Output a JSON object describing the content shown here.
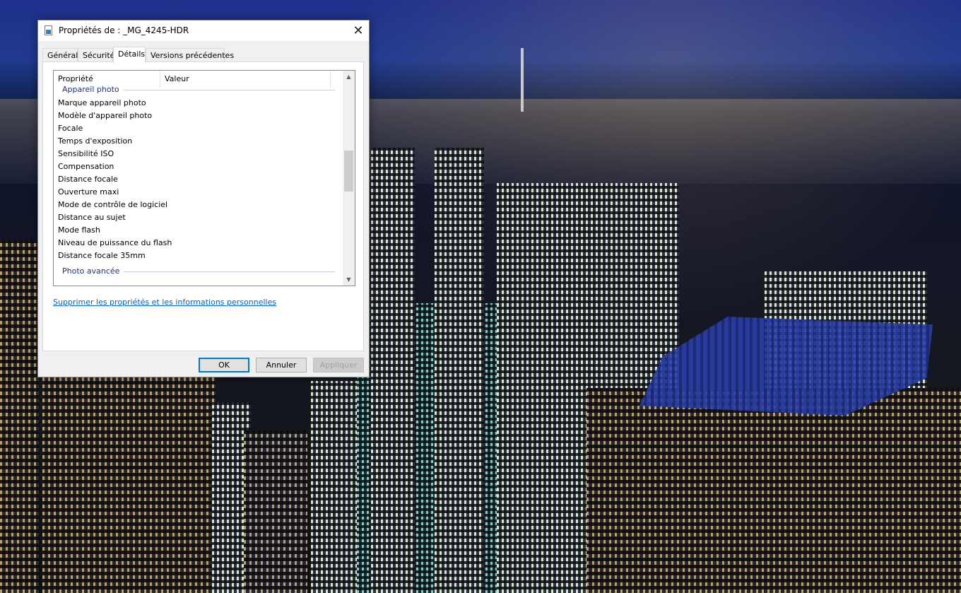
{
  "dialog": {
    "title": "Propriétés de : _MG_4245-HDR",
    "close_label": "✕",
    "tabs": [
      {
        "label": "Général"
      },
      {
        "label": "Sécurité"
      },
      {
        "label": "Détails"
      },
      {
        "label": "Versions précédentes"
      }
    ],
    "active_tab": "Détails",
    "columns": {
      "property": "Propriété",
      "value": "Valeur"
    },
    "groups": [
      {
        "label": "Appareil photo",
        "rows": [
          "Marque appareil photo",
          "Modèle d'appareil photo",
          "Focale",
          "Temps d'exposition",
          "Sensibilité ISO",
          "Compensation",
          "Distance focale",
          "Ouverture maxi",
          "Mode de contrôle de logiciel",
          "Distance au sujet",
          "Mode flash",
          "Niveau de puissance du flash",
          "Distance focale 35mm"
        ]
      },
      {
        "label": "Photo avancée",
        "rows": []
      }
    ],
    "scrollbar": {
      "up_icon": "▲",
      "down_icon": "▼",
      "scroll_position": 0.31
    },
    "remove_link": "Supprimer les propriétés et les informations personnelles",
    "buttons": {
      "ok": "OK",
      "cancel": "Annuler",
      "apply": "Appliquer"
    }
  },
  "colors": {
    "accent": "#0078d7",
    "group_label": "#1e3287",
    "link": "#0066cc"
  }
}
